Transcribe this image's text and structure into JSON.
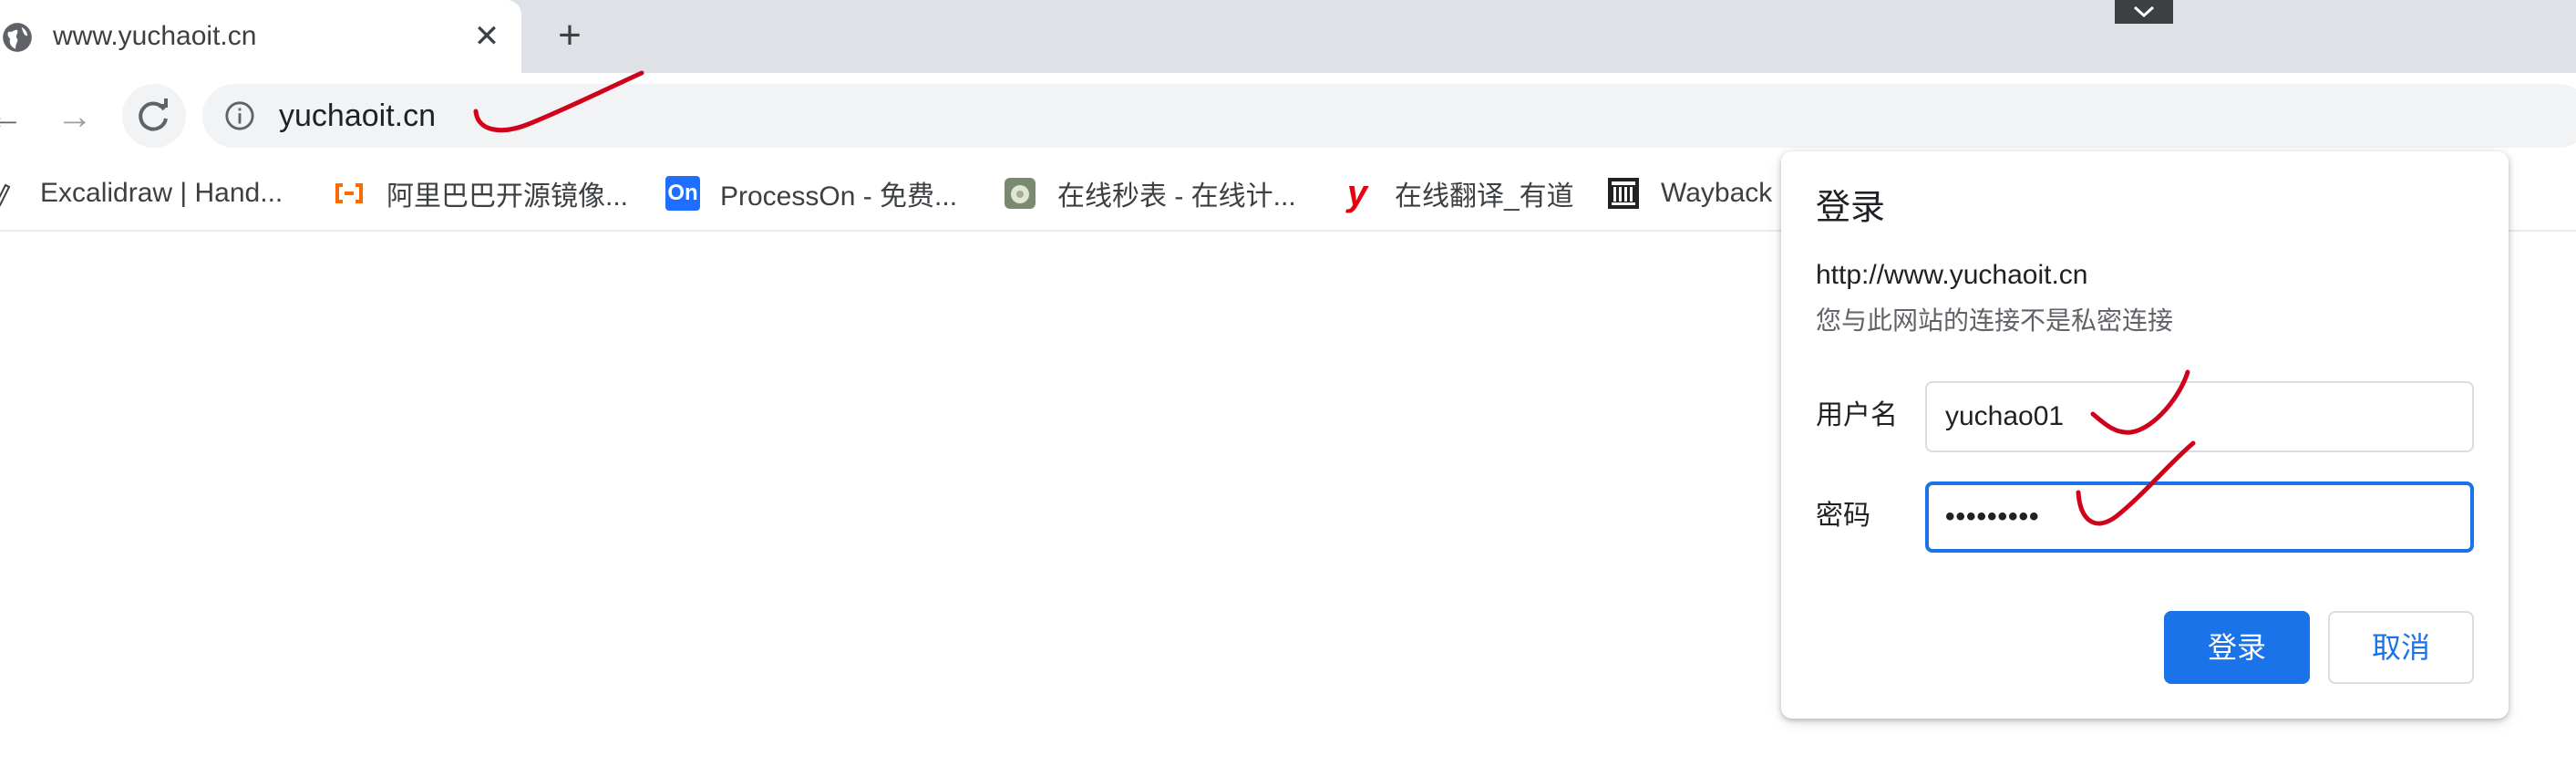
{
  "browser": {
    "tab": {
      "title": "www.yuchaoit.cn",
      "close_glyph": "✕"
    },
    "new_tab_glyph": "+",
    "toolbar": {
      "back_glyph": "←",
      "forward_glyph": "→",
      "reload_glyph": "↻",
      "address": "yuchaoit.cn"
    },
    "bookmarks": [
      {
        "label": "Excalidraw | Hand...",
        "icon": "excalidraw-icon"
      },
      {
        "label": "阿里巴巴开源镜像...",
        "icon": "aliyun-icon"
      },
      {
        "label": "ProcessOn - 免费...",
        "icon": "processon-icon",
        "icon_text": "On"
      },
      {
        "label": "在线秒表 - 在线计...",
        "icon": "stopwatch-icon"
      },
      {
        "label": "在线翻译_有道",
        "icon": "youdao-icon",
        "icon_text": "y"
      },
      {
        "label": "Wayback",
        "icon": "wayback-icon"
      }
    ]
  },
  "auth_dialog": {
    "title": "登录",
    "url": "http://www.yuchaoit.cn",
    "warning": "您与此网站的连接不是私密连接",
    "username_label": "用户名",
    "username_value": "yuchao01",
    "password_label": "密码",
    "password_value": "•••••••••",
    "login_button": "登录",
    "cancel_button": "取消"
  },
  "colors": {
    "accent": "#1a73e8",
    "tabstrip": "#dee1e6",
    "annotation": "#d0021b",
    "aliyun": "#ff6a00",
    "processon": "#1e6fff",
    "youdao": "#e60012"
  }
}
